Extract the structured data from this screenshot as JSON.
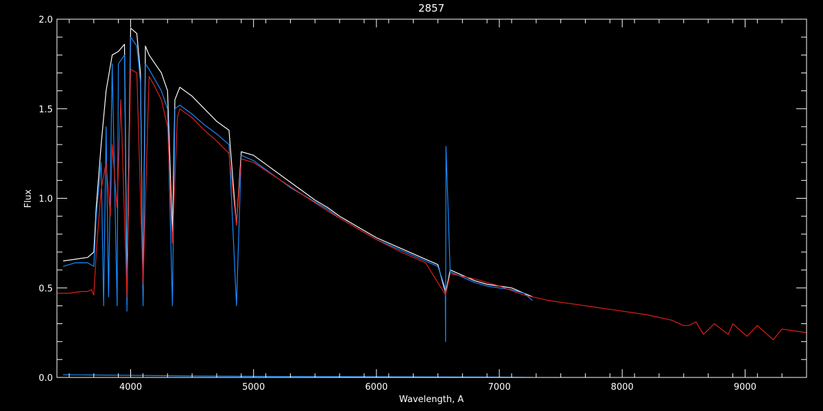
{
  "chart_data": {
    "type": "line",
    "title": "2857",
    "xlabel": "Wavelength, A",
    "ylabel": "Flux",
    "xlim": [
      3400,
      9500
    ],
    "ylim": [
      0.0,
      2.0
    ],
    "x_ticks": [
      4000,
      5000,
      6000,
      7000,
      8000,
      9000
    ],
    "x_tick_labels": [
      "4000",
      "5000",
      "6000",
      "7000",
      "8000",
      "9000"
    ],
    "y_ticks": [
      0.0,
      0.5,
      1.0,
      1.5,
      2.0
    ],
    "y_tick_labels": [
      "0.0",
      "0.5",
      "1.0",
      "1.5",
      "2.0"
    ],
    "grid": false,
    "colors": {
      "background": "#000000",
      "axes": "#ffffff"
    },
    "series": [
      {
        "color": "#ffffff",
        "x": [
          3450,
          3550,
          3650,
          3700,
          3720,
          3760,
          3800,
          3850,
          3900,
          3950,
          3970,
          4000,
          4050,
          4080,
          4101,
          4120,
          4150,
          4200,
          4250,
          4300,
          4340,
          4360,
          4400,
          4500,
          4600,
          4700,
          4800,
          4861,
          4900,
          5000,
          5100,
          5200,
          5300,
          5400,
          5500,
          5600,
          5700,
          5800,
          5900,
          6000,
          6100,
          6200,
          6300,
          6400,
          6500,
          6563,
          6600,
          6700,
          6800,
          6900,
          7000,
          7100,
          7200,
          7270
        ],
        "values": [
          0.65,
          0.66,
          0.67,
          0.7,
          0.95,
          1.3,
          1.6,
          1.8,
          1.82,
          1.86,
          0.5,
          1.95,
          1.92,
          1.7,
          0.45,
          1.85,
          1.8,
          1.75,
          1.7,
          1.6,
          0.8,
          1.55,
          1.62,
          1.57,
          1.5,
          1.43,
          1.38,
          0.85,
          1.26,
          1.24,
          1.19,
          1.14,
          1.09,
          1.04,
          0.99,
          0.95,
          0.9,
          0.86,
          0.82,
          0.78,
          0.75,
          0.72,
          0.69,
          0.66,
          0.63,
          0.47,
          0.6,
          0.57,
          0.54,
          0.52,
          0.51,
          0.5,
          0.47,
          0.45
        ]
      },
      {
        "color": "#1a8cff",
        "x": [
          3450,
          3550,
          3650,
          3700,
          3720,
          3760,
          3780,
          3800,
          3820,
          3850,
          3890,
          3900,
          3950,
          3970,
          4000,
          4050,
          4080,
          4101,
          4120,
          4150,
          4200,
          4250,
          4300,
          4340,
          4360,
          4400,
          4500,
          4600,
          4700,
          4800,
          4861,
          4900,
          5000,
          5100,
          5200,
          5300,
          5400,
          5500,
          5600,
          5700,
          5800,
          5900,
          6000,
          6100,
          6200,
          6300,
          6400,
          6500,
          6560,
          6563,
          6566,
          6600,
          6700,
          6800,
          6900,
          7000,
          7100,
          7200,
          7270
        ],
        "values": [
          0.62,
          0.64,
          0.64,
          0.62,
          0.9,
          1.2,
          0.4,
          1.4,
          0.45,
          1.75,
          0.4,
          1.75,
          1.8,
          0.37,
          1.9,
          1.85,
          1.65,
          0.4,
          1.75,
          1.72,
          1.66,
          1.6,
          1.5,
          0.4,
          1.5,
          1.52,
          1.47,
          1.41,
          1.36,
          1.3,
          0.4,
          1.24,
          1.21,
          1.16,
          1.11,
          1.06,
          1.02,
          0.98,
          0.94,
          0.89,
          0.85,
          0.81,
          0.77,
          0.74,
          0.71,
          0.68,
          0.65,
          0.62,
          0.5,
          0.2,
          1.29,
          0.59,
          0.56,
          0.53,
          0.51,
          0.5,
          0.49,
          0.47,
          0.43
        ]
      },
      {
        "color": "#e0201a",
        "x": [
          3400,
          3500,
          3600,
          3650,
          3680,
          3700,
          3720,
          3760,
          3800,
          3835,
          3850,
          3889,
          3920,
          3970,
          4000,
          4050,
          4101,
          4150,
          4200,
          4250,
          4300,
          4340,
          4380,
          4400,
          4500,
          4600,
          4700,
          4800,
          4861,
          4900,
          5000,
          5200,
          5400,
          5600,
          5800,
          6000,
          6200,
          6400,
          6563,
          6600,
          6800,
          7000,
          7200,
          7400,
          7600,
          7800,
          8000,
          8200,
          8400,
          8498,
          8542,
          8600,
          8662,
          8750,
          8863,
          8900,
          9015,
          9100,
          9229,
          9300,
          9400,
          9500
        ],
        "values": [
          0.47,
          0.47,
          0.48,
          0.48,
          0.49,
          0.46,
          0.7,
          1.05,
          1.2,
          0.9,
          1.3,
          0.95,
          1.55,
          0.45,
          1.72,
          1.7,
          0.52,
          1.68,
          1.62,
          1.55,
          1.4,
          0.75,
          1.45,
          1.5,
          1.45,
          1.38,
          1.32,
          1.25,
          0.85,
          1.22,
          1.2,
          1.11,
          1.02,
          0.93,
          0.85,
          0.77,
          0.7,
          0.64,
          0.46,
          0.58,
          0.55,
          0.51,
          0.46,
          0.43,
          0.41,
          0.39,
          0.37,
          0.35,
          0.32,
          0.29,
          0.29,
          0.31,
          0.24,
          0.3,
          0.24,
          0.3,
          0.23,
          0.29,
          0.21,
          0.27,
          0.26,
          0.25
        ]
      },
      {
        "color": "#1a8cff",
        "x": [
          3450,
          3600,
          3800,
          4000,
          4500,
          5000,
          5500,
          6000,
          6500,
          7000,
          7270
        ],
        "values": [
          0.015,
          0.014,
          0.013,
          0.012,
          0.008,
          0.006,
          0.005,
          0.004,
          0.003,
          0.002,
          0.0
        ]
      }
    ]
  }
}
